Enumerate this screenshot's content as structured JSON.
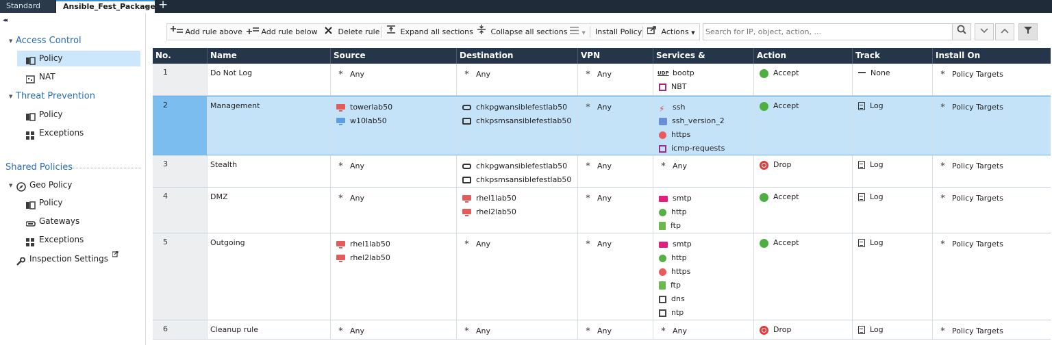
{
  "tabs": {
    "standard": "Standard",
    "active": "Ansible_Fest_Package",
    "close": "×",
    "add": "+"
  },
  "sidebar": {
    "collapse_glyph": "◂◂",
    "access_control": "Access Control",
    "ac_policy": "Policy",
    "ac_nat": "NAT",
    "threat_prevention": "Threat Prevention",
    "tp_policy": "Policy",
    "tp_exceptions": "Exceptions",
    "shared_policies": "Shared Policies",
    "geo_policy": "Geo Policy",
    "geo_policy_item": "Policy",
    "geo_gateways": "Gateways",
    "geo_exceptions": "Exceptions",
    "inspection_settings": "Inspection Settings"
  },
  "toolbar": {
    "add_above": "Add rule above",
    "add_below": "Add rule below",
    "delete_rule": "Delete rule",
    "expand_all": "Expand all sections",
    "collapse_all": "Collapse all sections",
    "install_policy": "Install Policy",
    "actions": "Actions"
  },
  "search": {
    "placeholder": "Search for IP, object, action, ..."
  },
  "table": {
    "columns": [
      "No.",
      "Name",
      "Source",
      "Destination",
      "VPN",
      "Services & Applications",
      "Action",
      "Track",
      "Install On"
    ],
    "rows": [
      {
        "no": "1",
        "name": "Do Not Log",
        "source": [
          "Any"
        ],
        "destination": [
          "Any"
        ],
        "vpn": "Any",
        "services": [
          "bootp",
          "NBT"
        ],
        "action": "Accept",
        "track": "None",
        "install_on": "Policy Targets"
      },
      {
        "no": "2",
        "name": "Management",
        "source": [
          "towerlab50",
          "w10lab50"
        ],
        "destination": [
          "chkpgwansiblefestlab50",
          "chkpsmsansiblefestlab50"
        ],
        "vpn": "Any",
        "services": [
          "ssh",
          "ssh_version_2",
          "https",
          "icmp-requests"
        ],
        "action": "Accept",
        "track": "Log",
        "install_on": "Policy Targets"
      },
      {
        "no": "3",
        "name": "Stealth",
        "source": [
          "Any"
        ],
        "destination": [
          "chkpgwansiblefestlab50",
          "chkpsmsansiblefestlab50"
        ],
        "vpn": "Any",
        "services": [
          "Any"
        ],
        "action": "Drop",
        "track": "Log",
        "install_on": "Policy Targets"
      },
      {
        "no": "4",
        "name": "DMZ",
        "source": [
          "Any"
        ],
        "destination": [
          "rhel1lab50",
          "rhel2lab50"
        ],
        "vpn": "Any",
        "services": [
          "smtp",
          "http",
          "ftp"
        ],
        "action": "Accept",
        "track": "Log",
        "install_on": "Policy Targets"
      },
      {
        "no": "5",
        "name": "Outgoing",
        "source": [
          "rhel1lab50",
          "rhel2lab50"
        ],
        "destination": [
          "Any"
        ],
        "vpn": "Any",
        "services": [
          "smtp",
          "http",
          "https",
          "ftp",
          "dns",
          "ntp"
        ],
        "action": "Accept",
        "track": "Log",
        "install_on": "Policy Targets"
      },
      {
        "no": "6",
        "name": "Cleanup rule",
        "source": [
          "Any"
        ],
        "destination": [
          "Any"
        ],
        "vpn": "Any",
        "services": [
          "Any"
        ],
        "action": "Drop",
        "track": "Log",
        "install_on": "Policy Targets"
      }
    ]
  },
  "colors": {
    "header_bg": "#25364b",
    "tabbar_bg": "#1f2b38",
    "selection": "#c4e3f9",
    "accent_link": "#2a6cb0",
    "accept": "#4caf3f",
    "drop": "#e03b3b"
  }
}
